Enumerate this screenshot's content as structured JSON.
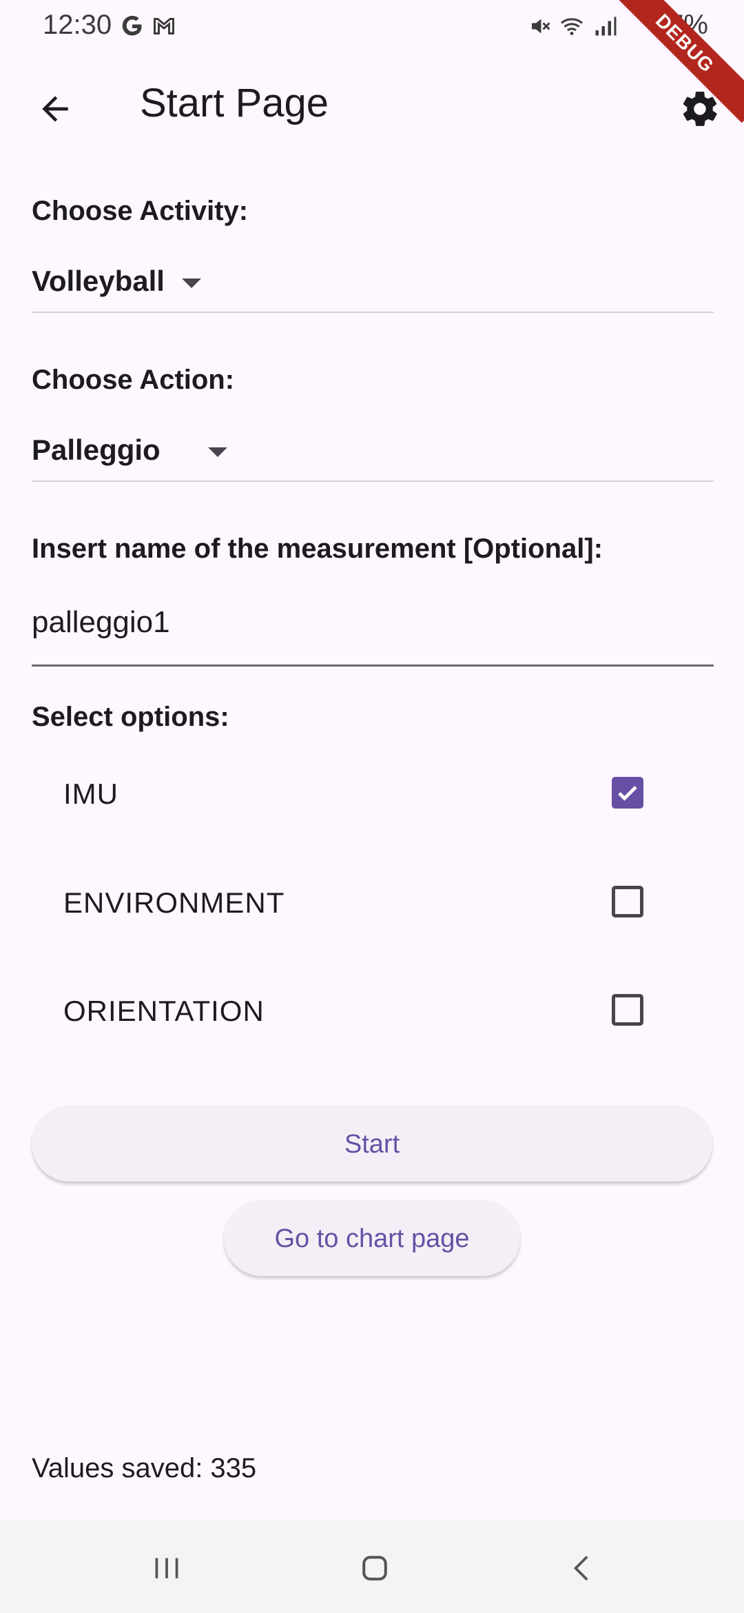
{
  "status_bar": {
    "time": "12:30",
    "battery": "37%",
    "icons": [
      "google-icon",
      "gmail-icon",
      "mute-icon",
      "wifi-icon",
      "signal-icon",
      "battery-icon"
    ]
  },
  "debug_banner": "DEBUG",
  "app_bar": {
    "title": "Start Page",
    "back_icon": "arrow-back-icon",
    "settings_icon": "gear-icon"
  },
  "activity": {
    "label": "Choose Activity:",
    "value": "Volleyball"
  },
  "action": {
    "label": "Choose Action:",
    "value": "Palleggio"
  },
  "measurement": {
    "label": "Insert name of the measurement [Optional]:",
    "value": "palleggio1"
  },
  "options": {
    "label": "Select options:",
    "items": [
      {
        "label": "IMU",
        "checked": true
      },
      {
        "label": "ENVIRONMENT",
        "checked": false
      },
      {
        "label": "ORIENTATION",
        "checked": false
      }
    ]
  },
  "buttons": {
    "start": "Start",
    "chart": "Go to chart page"
  },
  "values_saved": "Values saved: 335",
  "colors": {
    "background": "#FEF7FF",
    "accent": "#6750A4",
    "debug": "#B3261E"
  }
}
